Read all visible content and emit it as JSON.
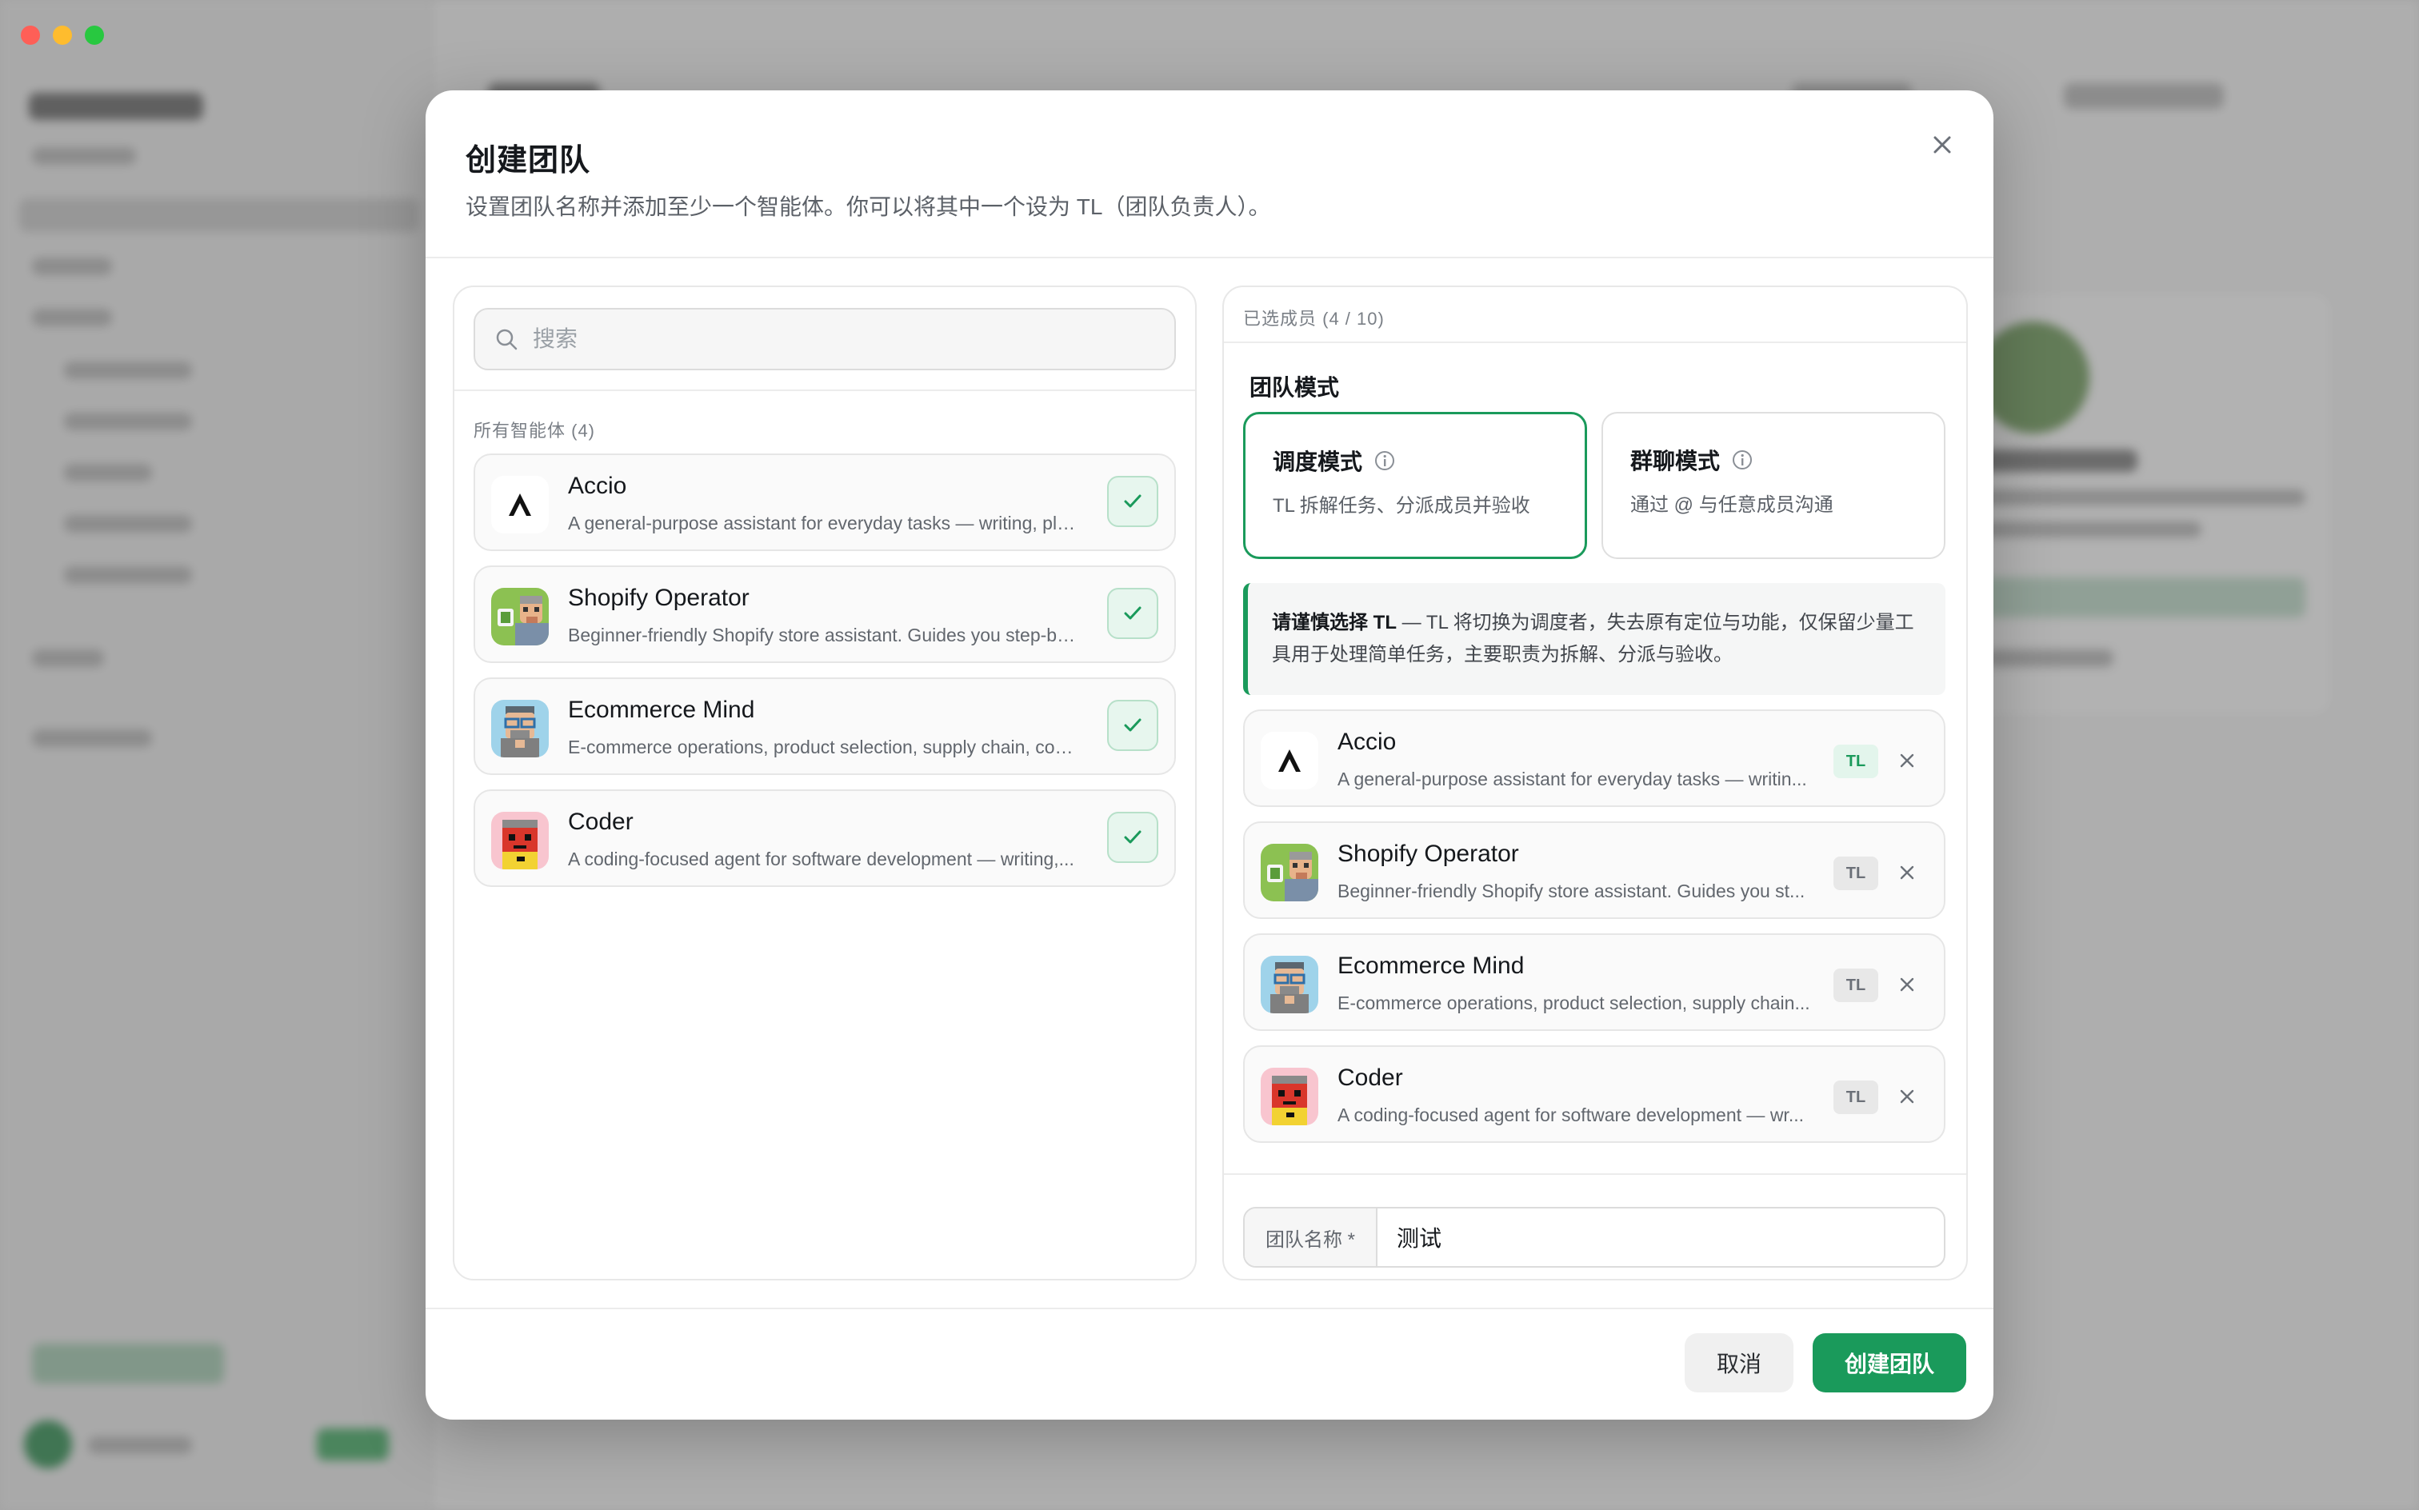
{
  "modal": {
    "title": "创建团队",
    "subtitle": "设置团队名称并添加至少一个智能体。你可以将其中一个设为 TL（团队负责人）。"
  },
  "search": {
    "placeholder": "搜索"
  },
  "all_agents": {
    "label": "所有智能体 (4)",
    "items": [
      {
        "name": "Accio",
        "description": "A general-purpose assistant for everyday tasks — writing, pla...",
        "selected": true,
        "avatar": "accio-logo"
      },
      {
        "name": "Shopify Operator",
        "description": "Beginner-friendly Shopify store assistant. Guides you step-by...",
        "selected": true,
        "avatar": "shopify-operator-avatar"
      },
      {
        "name": "Ecommerce Mind",
        "description": "E-commerce operations, product selection, supply chain, con...",
        "selected": true,
        "avatar": "ecommerce-mind-avatar"
      },
      {
        "name": "Coder",
        "description": "A coding-focused agent for software development — writing,...",
        "selected": true,
        "avatar": "coder-avatar"
      }
    ]
  },
  "selected_members": {
    "label": "已选成员 (4 / 10)",
    "team_mode_heading": "团队模式",
    "modes": [
      {
        "title": "调度模式",
        "description": "TL 拆解任务、分派成员并验收",
        "active": true
      },
      {
        "title": "群聊模式",
        "description": "通过 @ 与任意成员沟通",
        "active": false
      }
    ],
    "warning_bold": "请谨慎选择 TL",
    "warning_text": " — TL 将切换为调度者，失去原有定位与功能，仅保留少量工具用于处理简单任务，主要职责为拆解、分派与验收。",
    "members": [
      {
        "name": "Accio",
        "description": "A general-purpose assistant for everyday tasks — writin...",
        "tl_label": "TL",
        "is_tl": true
      },
      {
        "name": "Shopify Operator",
        "description": "Beginner-friendly Shopify store assistant. Guides you st...",
        "tl_label": "TL",
        "is_tl": false
      },
      {
        "name": "Ecommerce Mind",
        "description": "E-commerce operations, product selection, supply chain...",
        "tl_label": "TL",
        "is_tl": false
      },
      {
        "name": "Coder",
        "description": "A coding-focused agent for software development — wr...",
        "tl_label": "TL",
        "is_tl": false
      }
    ],
    "team_name_label": "团队名称 *",
    "team_name_value": "测试"
  },
  "footer": {
    "cancel_label": "取消",
    "create_label": "创建团队"
  },
  "colors": {
    "accent": "#1a9a5b",
    "check_bg": "#e7f6ee"
  }
}
